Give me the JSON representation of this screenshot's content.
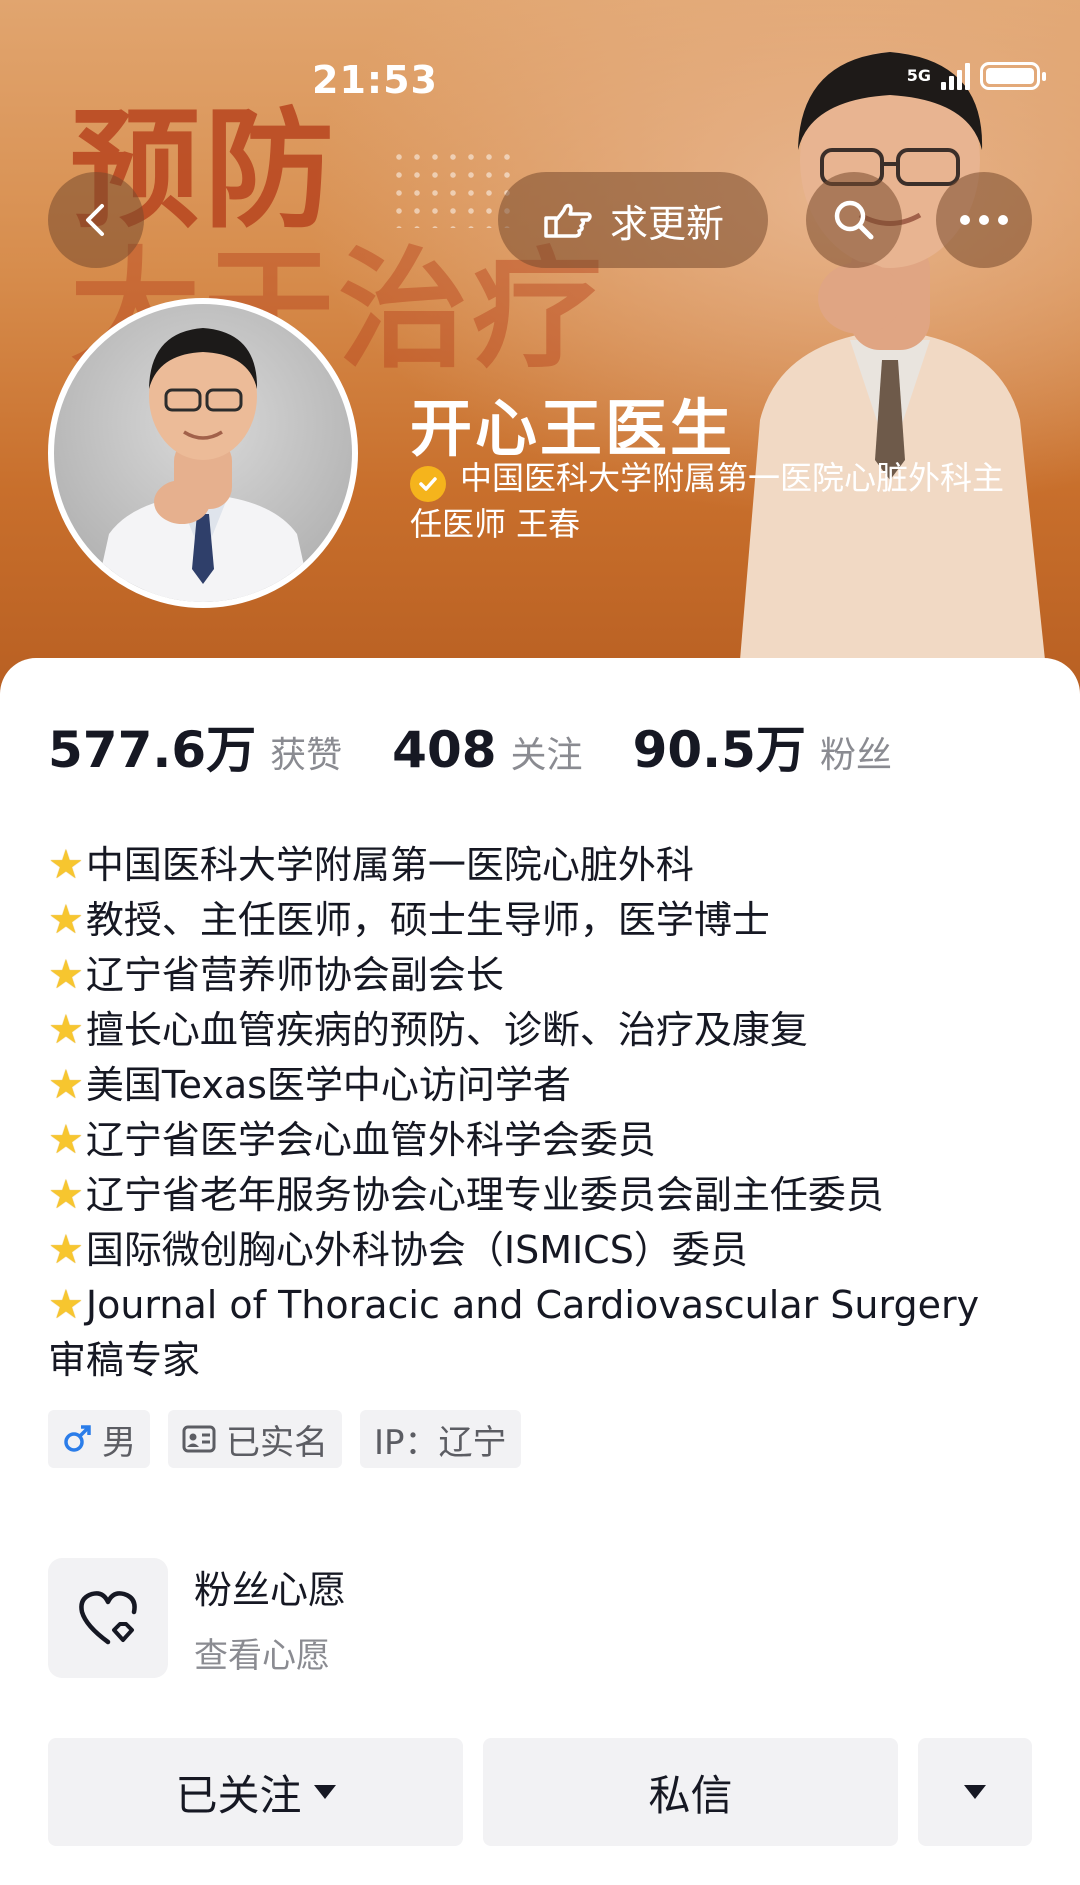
{
  "status_bar": {
    "time": "21:53",
    "network": "5G"
  },
  "banner": {
    "bg_text_line1": "预防",
    "bg_text_line2": "大于治疗"
  },
  "nav": {
    "update_label": "求更新"
  },
  "profile": {
    "name": "开心王医生",
    "verification": "中国医科大学附属第一医院心脏外科主任医师 王春"
  },
  "stats": [
    {
      "value": "577.6万",
      "label": "获赞"
    },
    {
      "value": "408",
      "label": "关注"
    },
    {
      "value": "90.5万",
      "label": "粉丝"
    }
  ],
  "bio": {
    "lines": [
      "中国医科大学附属第一医院心脏外科",
      "教授、主任医师，硕士生导师，医学博士",
      "辽宁省营养师协会副会长",
      "擅长心血管疾病的预防、诊断、治疗及康复",
      "美国Texas医学中心访问学者",
      "辽宁省医学会心血管外科学会委员",
      "辽宁省老年服务协会心理专业委员会副主任委员",
      "国际微创胸心外科协会（ISMICS）委员",
      "Journal of Thoracic and Cardiovascular Surgery"
    ],
    "continuation": "审稿专家"
  },
  "tags": {
    "gender": "男",
    "verified": "已实名",
    "ip": "IP：辽宁"
  },
  "wish": {
    "title": "粉丝心愿",
    "subtitle": "查看心愿"
  },
  "actions": {
    "follow_label": "已关注",
    "message_label": "私信"
  },
  "colors": {
    "banner": "#d78d4d",
    "verify_badge": "#f5b41c",
    "gender": "#2b7de9"
  }
}
